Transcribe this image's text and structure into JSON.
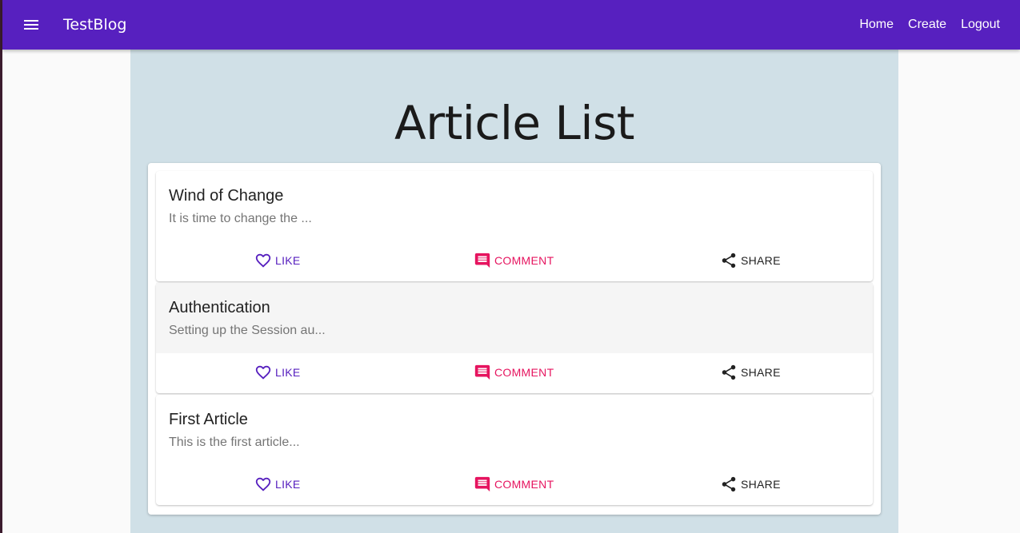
{
  "app": {
    "brand": "TestBlog"
  },
  "nav": {
    "home": "Home",
    "create": "Create",
    "logout": "Logout"
  },
  "page": {
    "title": "Article List"
  },
  "actions": {
    "like": "LIKE",
    "comment": "COMMENT",
    "share": "SHARE"
  },
  "articles": [
    {
      "title": "Wind of Change",
      "excerpt": "It is time to change the ..."
    },
    {
      "title": "Authentication",
      "excerpt": "Setting up the Session au..."
    },
    {
      "title": "First Article",
      "excerpt": "This is the first article..."
    }
  ],
  "colors": {
    "appbar": "#5720bf",
    "like": "#5720bf",
    "comment": "#e6145f",
    "background": "#d0e0e7"
  },
  "icons": {
    "menu": "menu-icon",
    "like": "heart-outline-icon",
    "comment": "comment-icon",
    "share": "share-icon"
  }
}
